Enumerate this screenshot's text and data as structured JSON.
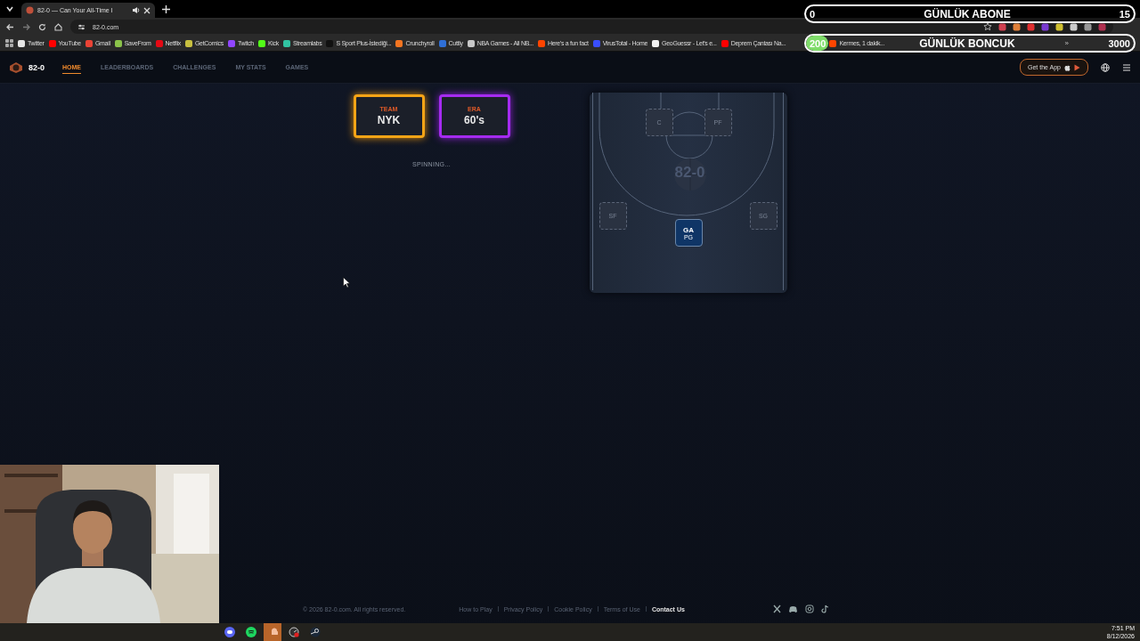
{
  "browser": {
    "tab": {
      "title": "82-0 — Can Your All-Time I",
      "audio": true
    },
    "address": "82-0.com",
    "bookmarks": [
      {
        "label": "Twitter",
        "color": "#e6e6e6"
      },
      {
        "label": "YouTube",
        "color": "#ff0000"
      },
      {
        "label": "Gmail",
        "color": "#ea4335"
      },
      {
        "label": "SaveFrom",
        "color": "#8bc34a"
      },
      {
        "label": "Netflix",
        "color": "#e50914"
      },
      {
        "label": "GetComics",
        "color": "#c8c040"
      },
      {
        "label": "Twitch",
        "color": "#9146ff"
      },
      {
        "label": "Kick",
        "color": "#53fc18"
      },
      {
        "label": "Streamlabs",
        "color": "#31c3a2"
      },
      {
        "label": "S Sport Plus-İstediği...",
        "color": "#111111"
      },
      {
        "label": "Crunchyroll",
        "color": "#f47521"
      },
      {
        "label": "Cuttly",
        "color": "#2f6fd6"
      },
      {
        "label": "NBA Games - All NB...",
        "color": "#c8c8c8"
      },
      {
        "label": "Here's a fun fact",
        "color": "#ff4500"
      },
      {
        "label": "VirusTotal - Home",
        "color": "#394eff"
      },
      {
        "label": "GeoGuessr - Let's e...",
        "color": "#f2f2f2"
      },
      {
        "label": "Deprem Çantası Na...",
        "color": "#ff0000"
      },
      {
        "label": "Kermes, 1 dakik...",
        "color": "#ff4500"
      }
    ],
    "bookmarks_more": "»"
  },
  "overlays": [
    {
      "title": "GÜNLÜK ABONE",
      "current": "0",
      "goal": "15",
      "level": 0
    },
    {
      "title": "GÜNLÜK BONCUK",
      "current": "200",
      "goal": "3000",
      "level": 0.0667
    }
  ],
  "nav": {
    "brand": "82-0",
    "items": [
      {
        "label": "HOME",
        "selected": true
      },
      {
        "label": "LEADERBOARDS",
        "selected": false
      },
      {
        "label": "CHALLENGES",
        "selected": false
      },
      {
        "label": "MY STATS",
        "selected": false
      },
      {
        "label": "GAMES",
        "selected": false
      }
    ],
    "app_button": "Get the App"
  },
  "spin": {
    "cards": [
      {
        "kind": "team",
        "label": "TEAM",
        "value": "NYK"
      },
      {
        "kind": "era",
        "label": "ERA",
        "value": "60's"
      }
    ],
    "status": "SPINNING..."
  },
  "court": {
    "watermark": "82-0",
    "slots": [
      {
        "position": "C",
        "filled": false
      },
      {
        "position": "PF",
        "filled": false
      },
      {
        "position": "SF",
        "filled": false
      },
      {
        "position": "SG",
        "filled": false
      },
      {
        "player": "GA",
        "position": "PG",
        "filled": true
      }
    ]
  },
  "footer": {
    "copyright": "© 2026 82-0.com. All rights reserved.",
    "links": [
      {
        "label": "How to Play",
        "highlighted": false
      },
      {
        "label": "Privacy Policy",
        "highlighted": false
      },
      {
        "label": "Cookie Policy",
        "highlighted": false
      },
      {
        "label": "Terms of Use",
        "highlighted": false
      },
      {
        "label": "Contact Us",
        "highlighted": true
      }
    ],
    "social": [
      {
        "kind": "x"
      },
      {
        "kind": "discord"
      },
      {
        "kind": "instagram"
      },
      {
        "kind": "tiktok"
      }
    ]
  },
  "taskbar": {
    "apps": [
      {
        "kind": "discord",
        "active": false
      },
      {
        "kind": "spotify",
        "active": false
      },
      {
        "kind": "soundcloud",
        "active": true
      },
      {
        "kind": "gauge",
        "active": false
      },
      {
        "kind": "steam",
        "active": false
      }
    ],
    "time": "7:51 PM",
    "date": "8/12/2026"
  }
}
